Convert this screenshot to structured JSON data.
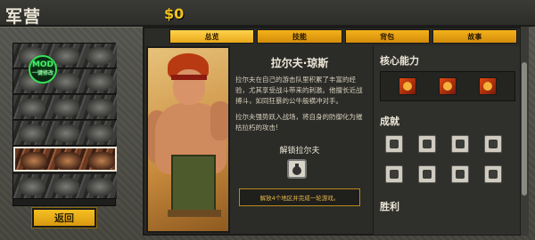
{
  "header": {
    "title": "军营",
    "money": "$0"
  },
  "roster": {
    "mod_badge_label": "MOD",
    "mod_badge_sub": "一键修改",
    "slots": [
      {
        "name": "slot-1",
        "selected": false
      },
      {
        "name": "slot-2",
        "selected": false
      },
      {
        "name": "slot-3",
        "selected": false
      },
      {
        "name": "slot-4",
        "selected": false
      },
      {
        "name": "slot-5",
        "selected": true
      },
      {
        "name": "slot-6",
        "selected": false
      }
    ],
    "back_label": "返回"
  },
  "tabs": [
    {
      "label": "总览",
      "active": true
    },
    {
      "label": "技能",
      "active": false
    },
    {
      "label": "背包",
      "active": false
    },
    {
      "label": "故事",
      "active": false
    }
  ],
  "hero": {
    "name": "拉尔夫·琼斯",
    "description_1": "拉尔夫在自己的游击队里积累了丰富的经验，尤其享受战斗带来的刺激。他擅长近战搏斗，如同狂暴的公牛般横冲对手。",
    "description_2": "拉尔夫强势跃入战场，将自身的防御化为摧枯拉朽的攻击!",
    "unlock_title": "解锁拉尔夫",
    "unlock_requirement": "解放4个地区并完成一轮游戏。"
  },
  "right_panel": {
    "core_title": "核心能力",
    "achievements_title": "成就",
    "victory_title": "胜利",
    "core_abilities": [
      "ability-1",
      "ability-2",
      "ability-3"
    ],
    "achievements": [
      "ach-1",
      "ach-2",
      "ach-3",
      "ach-4",
      "ach-5",
      "ach-6",
      "ach-7",
      "ach-8"
    ]
  },
  "colors": {
    "accent": "#f2c21b",
    "tab": "#f3b21a",
    "background": "#4a4a44",
    "mod_green": "#35e05a"
  }
}
